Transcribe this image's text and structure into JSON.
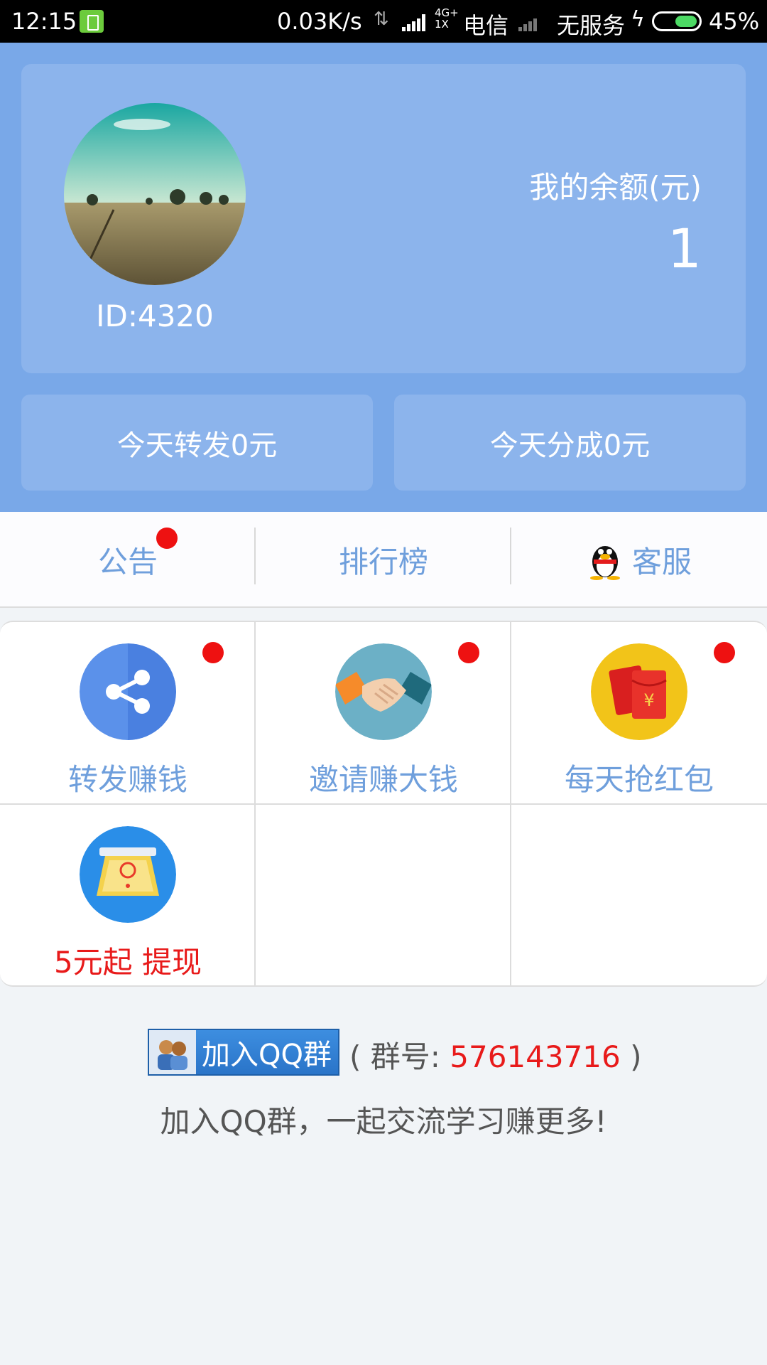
{
  "status_bar": {
    "time": "12:15",
    "speed": "0.03K/s",
    "network_type": "4G+",
    "network_sub": "1X",
    "carrier": "电信",
    "no_service": "无服务",
    "battery_percent": "45%",
    "battery_level": 0.45
  },
  "profile": {
    "user_id": "ID:4320",
    "balance_label": "我的余额(元)",
    "balance_value": "1"
  },
  "stats": {
    "forward_today": "今天转发0元",
    "share_today": "今天分成0元"
  },
  "tabs": [
    {
      "label": "公告",
      "has_dot": true
    },
    {
      "label": "排行榜",
      "has_dot": false
    },
    {
      "label": "客服",
      "icon": "qq-penguin-icon"
    }
  ],
  "grid": [
    {
      "label": "转发赚钱",
      "icon": "share-icon",
      "has_dot": true
    },
    {
      "label": "邀请赚大钱",
      "icon": "handshake-icon",
      "has_dot": true
    },
    {
      "label": "每天抢红包",
      "icon": "red-envelope-icon",
      "has_dot": true
    },
    {
      "label": "5元起 提现",
      "icon": "withdraw-icon",
      "has_dot": false
    }
  ],
  "footer": {
    "qq_button": "加入QQ群",
    "group_prefix": "( 群号: ",
    "group_number": "576143716",
    "group_suffix": " )",
    "tagline": "加入QQ群，一起交流学习赚更多!"
  },
  "colors": {
    "header_bg": "#79a8e8",
    "card_bg": "#8cb4ec",
    "label_blue": "#6f9fdc",
    "badge_red": "#ee1111",
    "highlight_red": "#e81a1a"
  }
}
